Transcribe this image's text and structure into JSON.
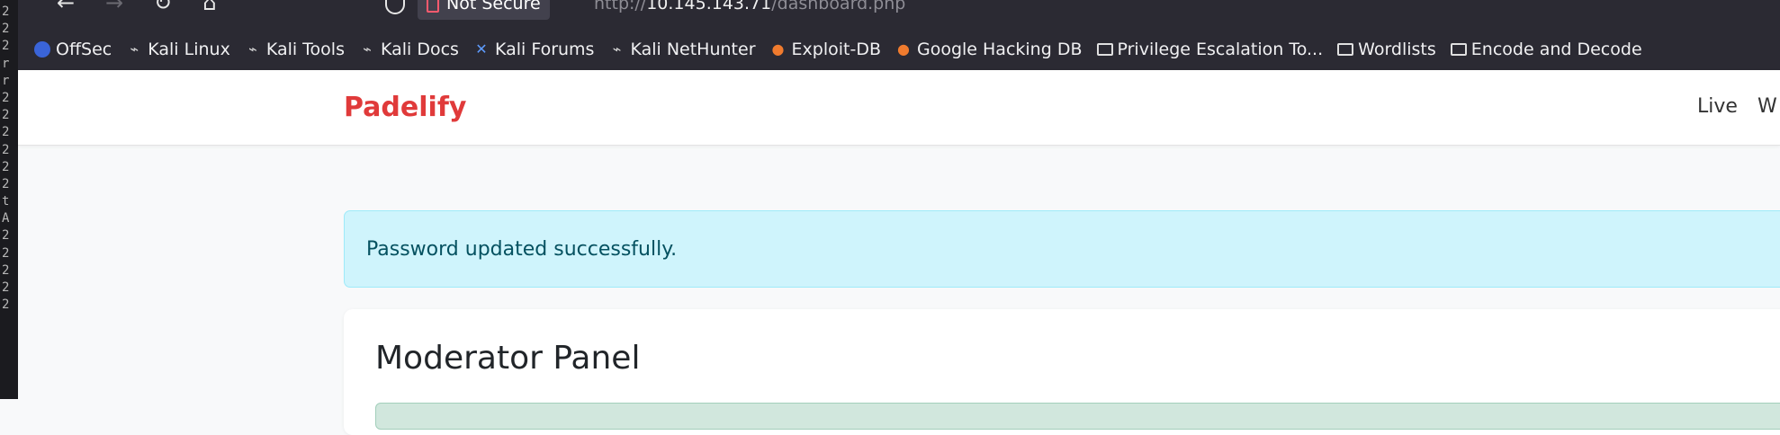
{
  "terminal": {
    "chars": [
      "2",
      "2",
      "2",
      "r",
      "r",
      "2",
      "2",
      "2",
      "2",
      "2",
      "2",
      "t",
      "A",
      "2",
      "2",
      "2",
      "2",
      "2"
    ]
  },
  "browser": {
    "nav_icons": {
      "back": "arrow-left-icon",
      "forward": "arrow-right-icon",
      "reload": "reload-icon",
      "home": "home-icon"
    },
    "security_label": "Not Secure",
    "url_scheme": "http://",
    "url_host": "10.145.143.71",
    "url_path": "/dashboard.php"
  },
  "bookmarks": [
    {
      "label": "OffSec",
      "icon": "offsec-icon"
    },
    {
      "label": "Kali Linux",
      "icon": "kali-dragon-icon"
    },
    {
      "label": "Kali Tools",
      "icon": "kali-dragon-icon"
    },
    {
      "label": "Kali Docs",
      "icon": "kali-dragon-icon"
    },
    {
      "label": "Kali Forums",
      "icon": "kali-forums-icon"
    },
    {
      "label": "Kali NetHunter",
      "icon": "kali-dragon-icon"
    },
    {
      "label": "Exploit-DB",
      "icon": "exploit-db-icon"
    },
    {
      "label": "Google Hacking DB",
      "icon": "exploit-db-icon"
    },
    {
      "label": "Privilege Escalation To...",
      "icon": "folder-icon"
    },
    {
      "label": "Wordlists",
      "icon": "folder-icon"
    },
    {
      "label": "Encode and Decode",
      "icon": "folder-icon"
    }
  ],
  "site": {
    "brand": "Padelify",
    "nav_links": [
      "Live",
      "W"
    ],
    "brand_color": "#e03a3a"
  },
  "alert": {
    "message": "Password updated successfully."
  },
  "panel": {
    "title": "Moderator Panel"
  }
}
